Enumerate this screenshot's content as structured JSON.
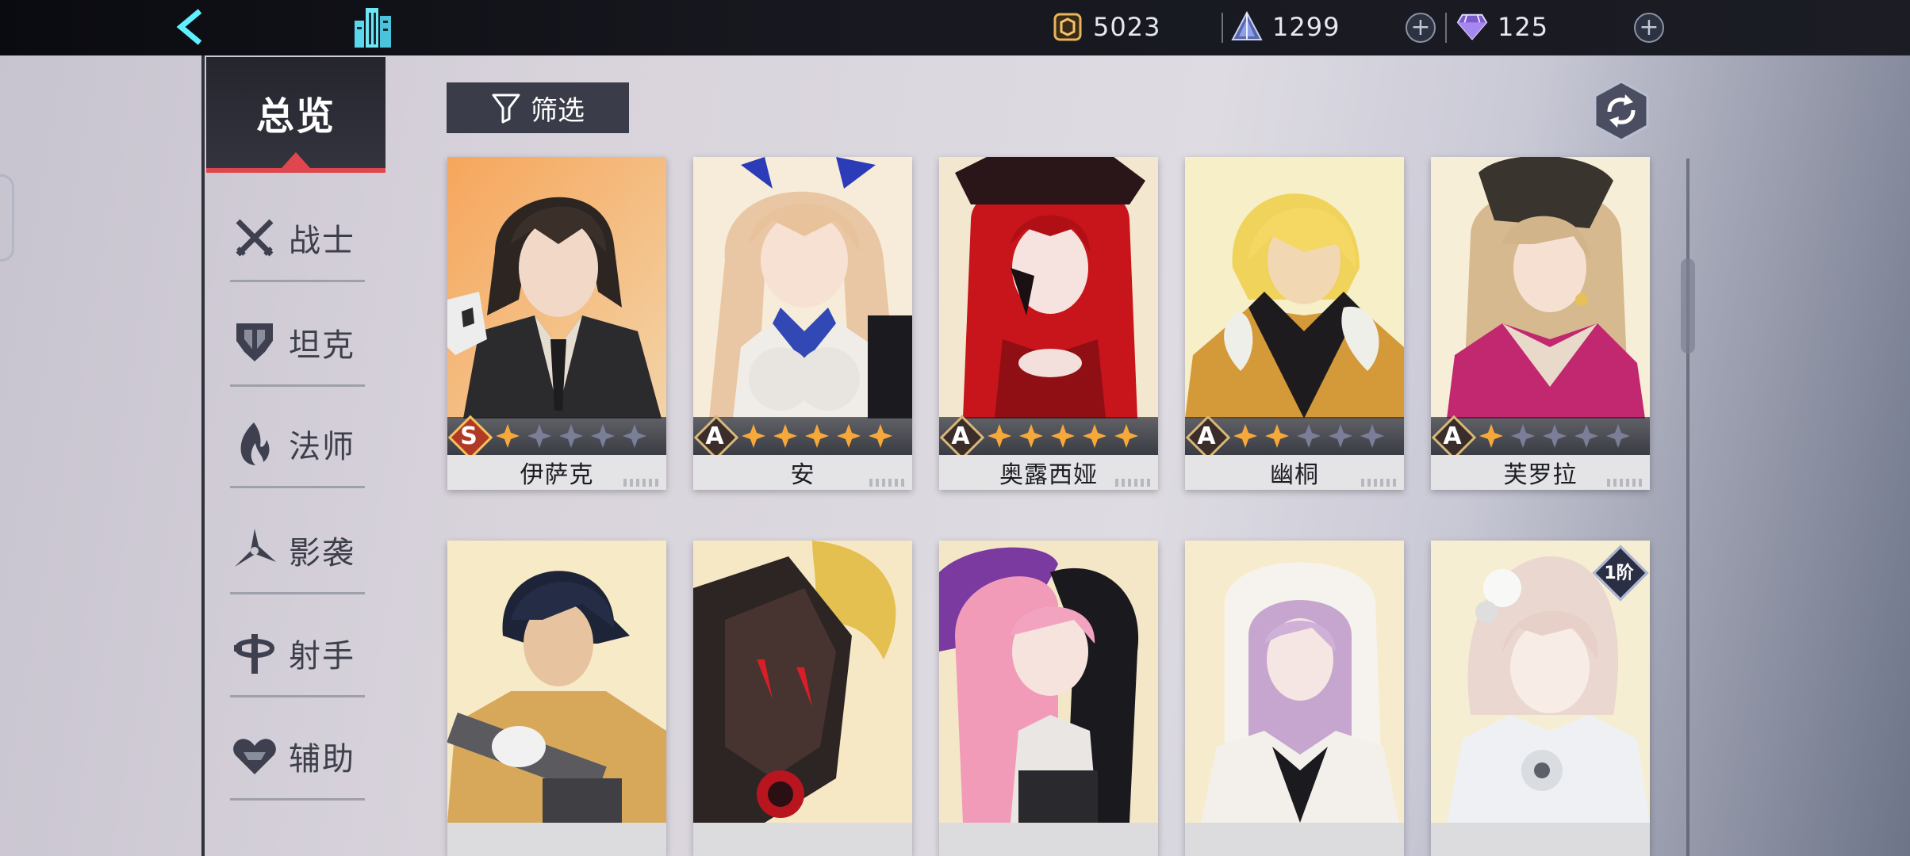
{
  "topbar": {
    "back_icon": "back-arrow-icon",
    "city_icon": "city-buildings-icon",
    "currencies": [
      {
        "icon": "gold-coin-icon",
        "value": "5023"
      },
      {
        "icon": "crystal-pyramid-icon",
        "value": "1299"
      },
      {
        "icon": "diamond-icon",
        "value": "125"
      }
    ],
    "plus_label": "+"
  },
  "sidebar": {
    "overview_label": "总览",
    "items": [
      {
        "label": "战士",
        "icon": "crossed-swords-icon"
      },
      {
        "label": "坦克",
        "icon": "shield-tank-icon"
      },
      {
        "label": "法师",
        "icon": "mage-flame-icon"
      },
      {
        "label": "影袭",
        "icon": "shadow-shuriken-icon"
      },
      {
        "label": "射手",
        "icon": "archer-crosshair-icon"
      },
      {
        "label": "辅助",
        "icon": "support-heart-icon"
      }
    ]
  },
  "filter": {
    "label": "筛选",
    "icon": "funnel-icon"
  },
  "refresh": {
    "icon": "refresh-arrows-icon"
  },
  "colors": {
    "accent": "#e0464d",
    "star_lit": "#f6a93a",
    "star_dim": "#7a7e97"
  },
  "heroes_row1": [
    {
      "name": "伊萨克",
      "rank": "S",
      "stars_lit": 1,
      "stars_total": 5
    },
    {
      "name": "安",
      "rank": "A",
      "stars_lit": 5,
      "stars_total": 5
    },
    {
      "name": "奥露西娅",
      "rank": "A",
      "stars_lit": 5,
      "stars_total": 5
    },
    {
      "name": "幽桐",
      "rank": "A",
      "stars_lit": 2,
      "stars_total": 5
    },
    {
      "name": "芙罗拉",
      "rank": "A",
      "stars_lit": 1,
      "stars_total": 5
    }
  ],
  "heroes_row2_tier": "1阶"
}
